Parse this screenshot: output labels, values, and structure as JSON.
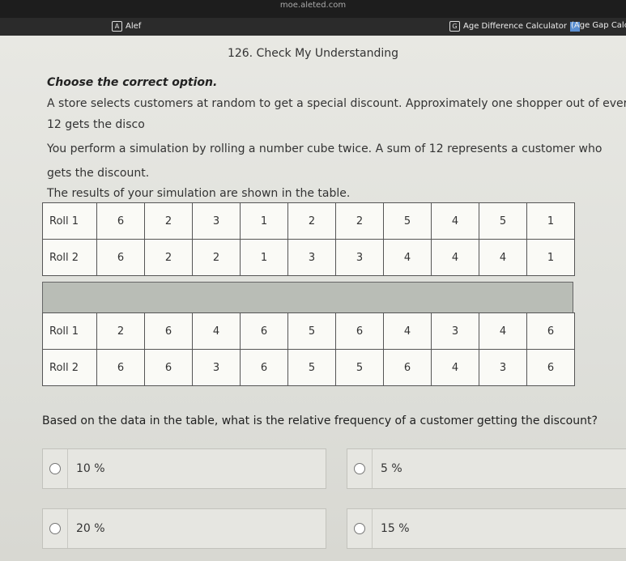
{
  "browser": {
    "url": "moe.aleted.com",
    "bookmarks": [
      {
        "label": "Alef",
        "icon": "A"
      },
      {
        "label": "Age Difference Calculator",
        "icon": "G"
      },
      {
        "label": "(Age Gap Calcu"
      }
    ]
  },
  "page": {
    "title": "126. Check My Understanding",
    "instruction": "Choose the correct option.",
    "paragraph_lines": [
      "A store selects customers at random to get a special discount. Approximately one shopper out of every",
      "12 gets the disco",
      "You perform a simulation by rolling a number cube twice. A sum of 12 represents a customer who",
      "gets the discount.",
      "The results of your simulation are shown in the table."
    ],
    "table1": {
      "roll1_label": "Roll 1",
      "roll1": [
        "6",
        "2",
        "3",
        "1",
        "2",
        "2",
        "5",
        "4",
        "5",
        "1"
      ],
      "roll2_label": "Roll 2",
      "roll2": [
        "6",
        "2",
        "2",
        "1",
        "3",
        "3",
        "4",
        "4",
        "4",
        "1"
      ]
    },
    "table2": {
      "roll1_label": "Roll 1",
      "roll1": [
        "2",
        "6",
        "4",
        "6",
        "5",
        "6",
        "4",
        "3",
        "4",
        "6"
      ],
      "roll2_label": "Roll 2",
      "roll2": [
        "6",
        "6",
        "3",
        "6",
        "5",
        "5",
        "6",
        "4",
        "3",
        "6"
      ]
    },
    "question": "Based on the data in the table, what is the relative frequency of a customer getting the discount?",
    "options": [
      "10 %",
      "5 %",
      "20 %",
      "15 %"
    ]
  }
}
